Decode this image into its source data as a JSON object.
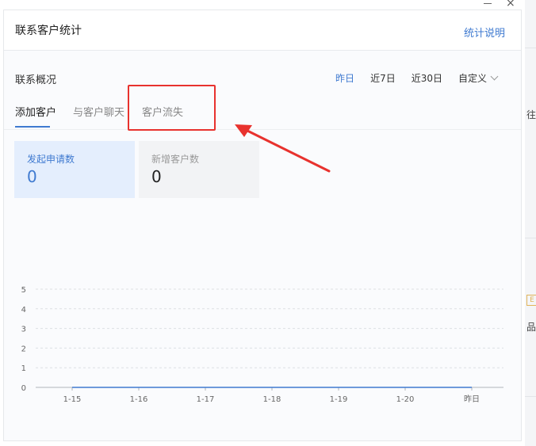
{
  "header": {
    "title": "联系客户统计",
    "help_link": "统计说明"
  },
  "overview": {
    "title": "联系概况",
    "ranges": [
      {
        "label": "昨日",
        "active": true
      },
      {
        "label": "近7日",
        "active": false
      },
      {
        "label": "近30日",
        "active": false
      },
      {
        "label": "自定义",
        "active": false
      }
    ]
  },
  "tabs": [
    {
      "label": "添加客户",
      "active": true
    },
    {
      "label": "与客户聊天",
      "active": false
    },
    {
      "label": "客户流失",
      "active": false
    }
  ],
  "stats": [
    {
      "label": "发起申请数",
      "value": "0",
      "active": true
    },
    {
      "label": "新增客户数",
      "value": "0",
      "active": false
    }
  ],
  "background": {
    "fragment_1": "往",
    "fragment_2": "品",
    "badge": "E"
  },
  "colors": {
    "accent": "#3f7ad0",
    "annotation": "#e8322e"
  },
  "chart_data": {
    "type": "line",
    "categories": [
      "1-15",
      "1-16",
      "1-17",
      "1-18",
      "1-19",
      "1-20",
      "昨日"
    ],
    "series": [
      {
        "values": [
          0,
          0,
          0,
          0,
          0,
          0,
          0
        ]
      }
    ],
    "yticks": [
      "0",
      "1",
      "2",
      "3",
      "4",
      "5"
    ],
    "ylim": [
      0,
      5
    ],
    "grid": true,
    "title": "",
    "xlabel": "",
    "ylabel": ""
  }
}
